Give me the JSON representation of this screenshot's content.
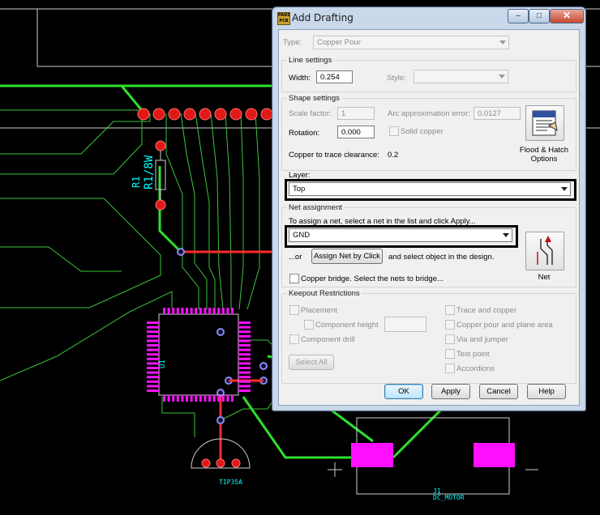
{
  "pcb": {
    "ref_r1": "R1",
    "val_r1": "R1/8W",
    "ref_u1": "U1",
    "part_tip": "TIP35A",
    "ref_j1": "J1",
    "part_motor": "DC_MOTOR"
  },
  "dialog": {
    "app_icon_text": "PADS PCB",
    "title": "Add Drafting",
    "controls": {
      "minimize": "–",
      "maximize": "□",
      "close": "✕"
    },
    "type_label": "Type:",
    "type_value": "Copper Pour",
    "line_settings": {
      "title": "Line settings",
      "width_label": "Width:",
      "width_value": "0.254",
      "style_label": "Style:",
      "style_value": ""
    },
    "shape_settings": {
      "title": "Shape settings",
      "scale_label": "Scale factor:",
      "scale_value": "1",
      "arc_label": "Arc approximation error:",
      "arc_value": "0.0127",
      "rotation_label": "Rotation:",
      "rotation_value": "0.000",
      "solid_copper_label": "Solid copper",
      "clearance_label": "Copper to trace clearance:",
      "clearance_value": "0.2",
      "flood_button_label_1": "Flood & Hatch",
      "flood_button_label_2": "Options"
    },
    "layer": {
      "title": "Layer:",
      "value": "Top"
    },
    "net_assignment": {
      "title": "Net assignment",
      "instruction": "To assign a net, select a net in the list and click Apply...",
      "net_value": "GND",
      "or_label": "...or",
      "assign_button": "Assign Net by Click",
      "select_text": "and select object in the design.",
      "bridge_label": "Copper bridge. Select the nets to bridge...",
      "net_button_label": "Net"
    },
    "keepout": {
      "title": "Keepout Restrictions",
      "placement": "Placement",
      "component_height": "Component height",
      "component_height_value": "",
      "component_drill": "Component drill",
      "trace_copper": "Trace and copper",
      "copper_pour": "Copper pour and plane area",
      "via_jumper": "Via and jumper",
      "test_point": "Test point",
      "accordions": "Accordions",
      "select_all": "Select All"
    },
    "buttons": {
      "ok": "OK",
      "apply": "Apply",
      "cancel": "Cancel",
      "help": "Help"
    }
  }
}
